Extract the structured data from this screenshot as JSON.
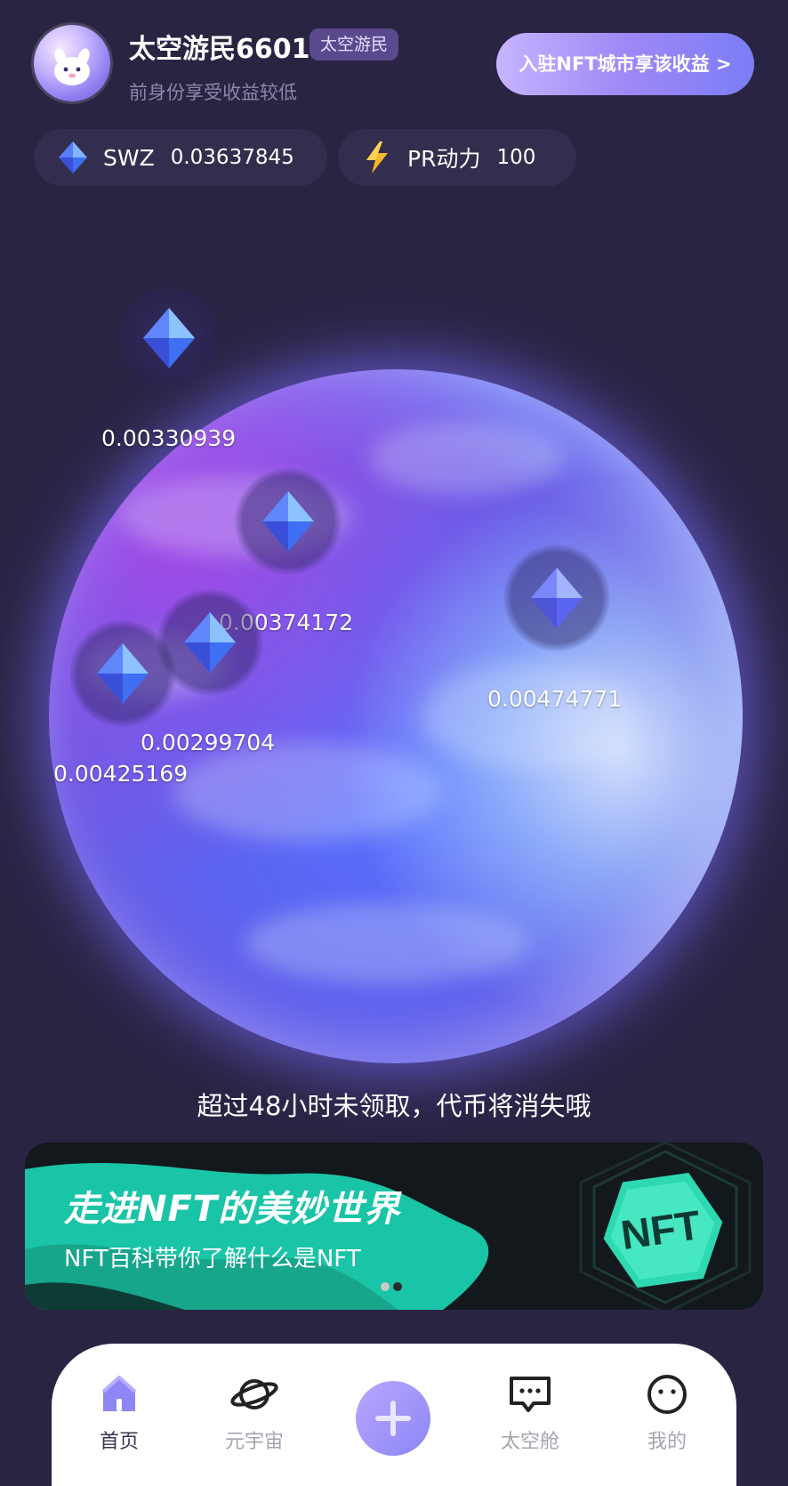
{
  "header": {
    "username": "太空游民6601",
    "level_badge": "太空游民",
    "subtitle": "前身份享受收益较低",
    "join_button": "入驻NFT城市享该收益 >"
  },
  "stats": {
    "swz": {
      "label": "SWZ",
      "value": "0.03637845",
      "icon": "diamond-icon"
    },
    "pr": {
      "label": "PR动力",
      "value": "100",
      "icon": "lightning-icon"
    }
  },
  "crystals": [
    {
      "value": "0.00330939"
    },
    {
      "value": "0.00374172"
    },
    {
      "value": "0.00299704"
    },
    {
      "value": "0.00425169"
    },
    {
      "value": "0.00474771"
    }
  ],
  "warning": "超过48小时未领取，代币将消失哦",
  "banner": {
    "title": "走进NFT的美妙世界",
    "subtitle": "NFT百科带你了解什么是NFT",
    "badge": "NFT"
  },
  "nav": {
    "items": [
      {
        "label": "首页",
        "icon": "home-icon",
        "active": true
      },
      {
        "label": "元宇宙",
        "icon": "planet-icon",
        "active": false
      },
      {
        "label": "",
        "icon": "plus-icon",
        "active": false
      },
      {
        "label": "太空舱",
        "icon": "chat-icon",
        "active": false
      },
      {
        "label": "我的",
        "icon": "profile-icon",
        "active": false
      }
    ]
  },
  "colors": {
    "background": "#2a2443",
    "accent": "#8b86f5",
    "stat_bg": "#342e4e"
  }
}
